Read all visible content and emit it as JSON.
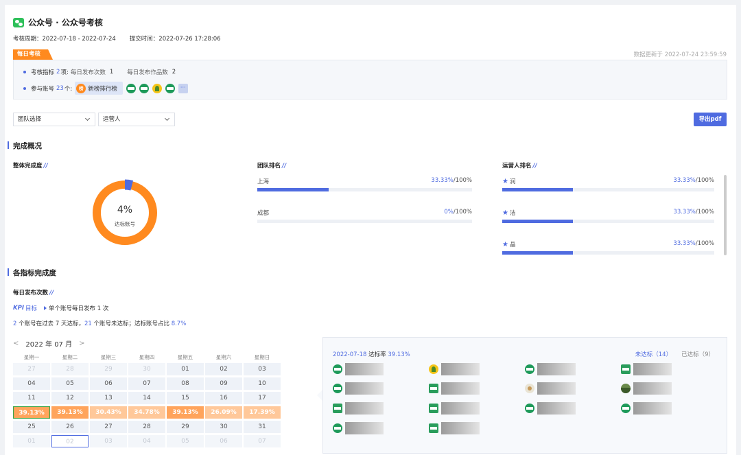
{
  "header": {
    "title": "公众号 · 公众号考核",
    "period_label": "考核周期：2022-07-18 - 2022-07-24",
    "submit_label": "提交时间：2022-07-26 17:28:06"
  },
  "daily_tag": "每日考核",
  "update_time": "数据更新于 2022-07-24 23:59:59",
  "info": {
    "indicators_prefix": "考核指标",
    "indicators_count": "2",
    "indicators_suffix": "项:",
    "ind1_label": "每日发布次数",
    "ind1_value": "1",
    "ind2_label": "每日发布作品数",
    "ind2_value": "2",
    "accounts_prefix": "参与账号",
    "accounts_count": "23",
    "accounts_suffix": "个:",
    "featured_account_logo": "榜",
    "featured_account_name": "新榜排行榜",
    "more": "···"
  },
  "filters": {
    "team_select": "团队选择",
    "operator_select": "运营人"
  },
  "export_button": "导出pdf",
  "overview": {
    "heading": "完成概况",
    "overall_title": "整体完成度",
    "overall_value": 4,
    "overall_display": "4%",
    "overall_label": "达标账号",
    "team_title": "团队排名",
    "team_ranks": [
      {
        "name": "上海",
        "pct": "33.33%",
        "total": "/100%",
        "value": 33.33
      },
      {
        "name": "成都",
        "pct": "0%",
        "total": "/100%",
        "value": 0
      }
    ],
    "operator_title": "运营人排名",
    "operator_ranks": [
      {
        "name": "润",
        "pct": "33.33%",
        "total": "/100%",
        "value": 33.33
      },
      {
        "name": "洁",
        "pct": "33.33%",
        "total": "/100%",
        "value": 33.33
      },
      {
        "name": "晶",
        "pct": "33.33%",
        "total": "/100%",
        "value": 33.33
      }
    ]
  },
  "indicators": {
    "heading": "各指标完成度",
    "daily_title": "每日发布次数",
    "kpi_tag": "KPI",
    "kpi_word": "目标",
    "kpi_desc": "单个账号每日发布 1 次",
    "stat": {
      "n1": "2",
      "t1": " 个账号在过去 ",
      "n2": "7",
      "t2": " 天达标，",
      "n3": "21",
      "t3": " 个账号未达标；达标账号占比 ",
      "n4": "8.7%"
    }
  },
  "calendar": {
    "prev": "<",
    "next": ">",
    "month": "2022 年 07 月",
    "weekdays": [
      "星期一",
      "星期二",
      "星期三",
      "星期四",
      "星期五",
      "星期六",
      "星期日"
    ],
    "rows": [
      [
        "27",
        "28",
        "29",
        "30",
        "01",
        "02",
        "03"
      ],
      [
        "04",
        "05",
        "06",
        "07",
        "08",
        "09",
        "10"
      ],
      [
        "11",
        "12",
        "13",
        "14",
        "15",
        "16",
        "17"
      ],
      [
        "39.13%",
        "39.13%",
        "30.43%",
        "34.78%",
        "39.13%",
        "26.09%",
        "17.39%"
      ],
      [
        "25",
        "26",
        "27",
        "28",
        "29",
        "30",
        "31"
      ],
      [
        "01",
        "02",
        "03",
        "04",
        "05",
        "06",
        "07"
      ]
    ]
  },
  "detail": {
    "date": "2022-07-18",
    "rate_label": "达标率",
    "rate": "39.13%",
    "tab_unmet": "未达标（14）",
    "tab_met": "已达标（9）"
  }
}
